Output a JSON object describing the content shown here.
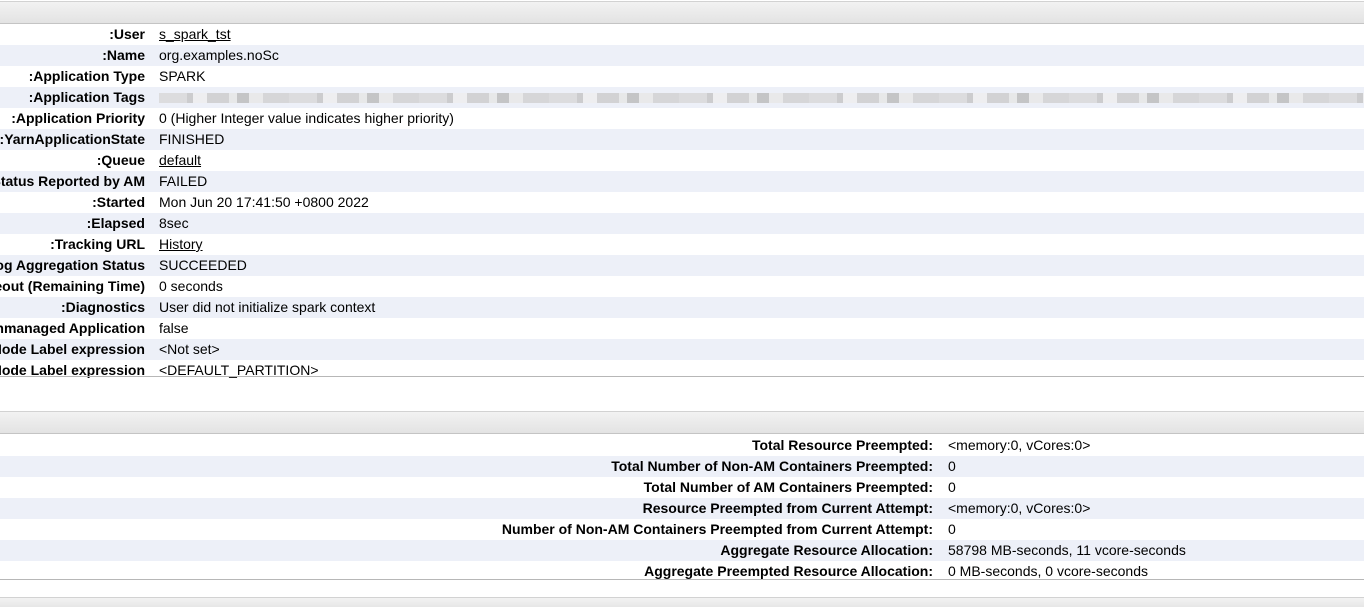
{
  "overview": {
    "rows": [
      {
        "label": "User:",
        "value": "s_spark_tst",
        "link": true
      },
      {
        "label": "Name:",
        "value": "org.examples.noSc",
        "link": false
      },
      {
        "label": "Application Type:",
        "value": "SPARK",
        "link": false
      },
      {
        "label": "Application Tags:",
        "value": "",
        "link": false,
        "redacted": true
      },
      {
        "label": "Application Priority:",
        "value": "0 (Higher Integer value indicates higher priority)",
        "link": false
      },
      {
        "label": "YarnApplicationState:",
        "value": "FINISHED",
        "link": false
      },
      {
        "label": "Queue:",
        "value": "default",
        "link": true
      },
      {
        "label": "FinalStatus Reported by AM:",
        "value": "FAILED",
        "link": false
      },
      {
        "label": "Started:",
        "value": "Mon Jun 20 17:41:50 +0800 2022",
        "link": false
      },
      {
        "label": "Elapsed:",
        "value": "8sec",
        "link": false
      },
      {
        "label": "Tracking URL:",
        "value": "History",
        "link": true
      },
      {
        "label": "Log Aggregation Status:",
        "value": "SUCCEEDED",
        "link": false
      },
      {
        "label": "Application Timeout (Remaining Time):",
        "value": "0 seconds",
        "link": false
      },
      {
        "label": "Diagnostics:",
        "value": "User did not initialize spark context",
        "link": false
      },
      {
        "label": "Unmanaged Application:",
        "value": "false",
        "link": false
      },
      {
        "label": "Application Node Label expression:",
        "value": "<Not set>",
        "link": false
      },
      {
        "label": "AM container Node Label expression:",
        "value": "<DEFAULT_PARTITION>",
        "link": false
      }
    ]
  },
  "metrics": {
    "rows": [
      {
        "label": "Total Resource Preempted:",
        "value": "<memory:0, vCores:0>"
      },
      {
        "label": "Total Number of Non-AM Containers Preempted:",
        "value": "0"
      },
      {
        "label": "Total Number of AM Containers Preempted:",
        "value": "0"
      },
      {
        "label": "Resource Preempted from Current Attempt:",
        "value": "<memory:0, vCores:0>"
      },
      {
        "label": "Number of Non-AM Containers Preempted from Current Attempt:",
        "value": "0"
      },
      {
        "label": "Aggregate Resource Allocation:",
        "value": "58798 MB-seconds, 11 vcore-seconds"
      },
      {
        "label": "Aggregate Preempted Resource Allocation:",
        "value": "0 MB-seconds, 0 vcore-seconds"
      }
    ]
  }
}
